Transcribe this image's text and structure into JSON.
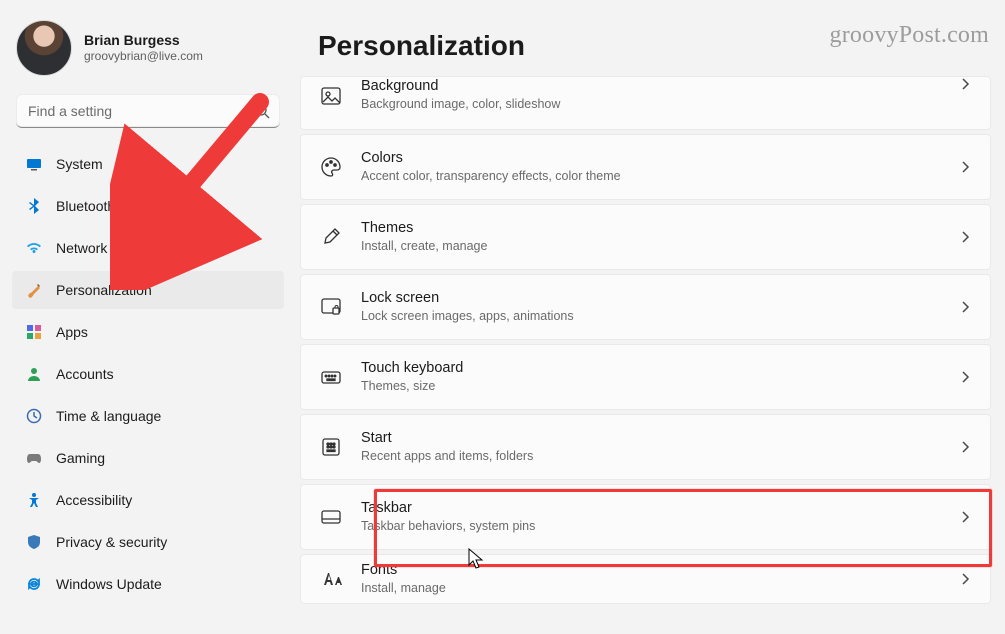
{
  "watermark": "groovyPost.com",
  "user": {
    "name": "Brian Burgess",
    "email": "groovybrian@live.com"
  },
  "search": {
    "placeholder": "Find a setting"
  },
  "heading": "Personalization",
  "nav": [
    {
      "id": "system",
      "label": "System"
    },
    {
      "id": "bluetooth",
      "label": "Bluetooth & devices"
    },
    {
      "id": "network",
      "label": "Network & internet"
    },
    {
      "id": "personalization",
      "label": "Personalization"
    },
    {
      "id": "apps",
      "label": "Apps"
    },
    {
      "id": "accounts",
      "label": "Accounts"
    },
    {
      "id": "time",
      "label": "Time & language"
    },
    {
      "id": "gaming",
      "label": "Gaming"
    },
    {
      "id": "accessibility",
      "label": "Accessibility"
    },
    {
      "id": "privacy",
      "label": "Privacy & security"
    },
    {
      "id": "update",
      "label": "Windows Update"
    }
  ],
  "cards": {
    "background": {
      "title": "Background",
      "sub": "Background image, color, slideshow"
    },
    "colors": {
      "title": "Colors",
      "sub": "Accent color, transparency effects, color theme"
    },
    "themes": {
      "title": "Themes",
      "sub": "Install, create, manage"
    },
    "lockscreen": {
      "title": "Lock screen",
      "sub": "Lock screen images, apps, animations"
    },
    "touchkb": {
      "title": "Touch keyboard",
      "sub": "Themes, size"
    },
    "start": {
      "title": "Start",
      "sub": "Recent apps and items, folders"
    },
    "taskbar": {
      "title": "Taskbar",
      "sub": "Taskbar behaviors, system pins"
    },
    "fonts": {
      "title": "Fonts",
      "sub": "Install, manage"
    }
  },
  "colors": {
    "highlight": "#ef3a3a",
    "accent_blue": "#0078d4"
  }
}
